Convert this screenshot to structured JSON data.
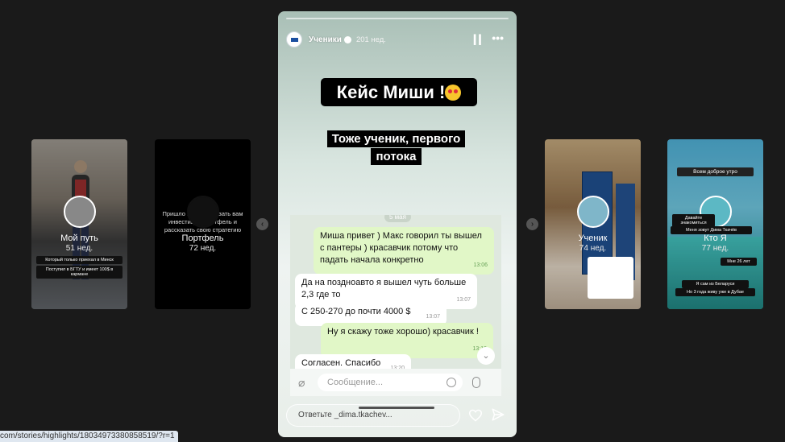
{
  "highlights": [
    {
      "name": "Мой путь",
      "age": "51 нед.",
      "tags": [
        "Который только приехал в Минск",
        "Поступил в БГТУ и имеет 100$ в кармане"
      ]
    },
    {
      "name": "Портфель",
      "age": "72 нед.",
      "text": "Пришло время показать вам инвестиции, портфель и рассказать свою стратегию"
    },
    {
      "name": "Ученик",
      "age": "74 нед."
    },
    {
      "name": "Кто Я",
      "age": "77 нед.",
      "tags": [
        "Всем доброе утро",
        "Давайте знакомиться",
        "Меня зовут Дима Ткачёв",
        "Мне 26 лет",
        "Я сам из Беларуси",
        "Но 3 года живу уже в Дубае"
      ]
    }
  ],
  "story": {
    "user": "Ученики",
    "time": "201 нед.",
    "caption_main": "Кейс Миши !",
    "caption_sub": "Тоже ученик, первого потока",
    "chat": {
      "date": "5 мая",
      "messages": [
        {
          "dir": "out",
          "text": "Миша привет ) Макс говорил ты вышел с пантеры ) красавчик потому что падать начала конкретно",
          "time": "13:06"
        },
        {
          "dir": "in",
          "text": "Да на поздноавто я вышел чуть больше 2,3 где то",
          "time": "13:07"
        },
        {
          "dir": "in",
          "text": "С 250-270 до почти 4000 $",
          "time": "13:07"
        },
        {
          "dir": "out",
          "text": "Ну я скажу тоже хорошо) красавчик !",
          "time": "13:19"
        },
        {
          "dir": "in",
          "text": "Согласен. Спасибо",
          "time": "13:20"
        }
      ],
      "input_placeholder": "Сообщение..."
    },
    "reply_placeholder": "Ответьте _dima.tkachev..."
  },
  "status_url": "com/stories/highlights/18034973380858519/?r=1",
  "icons": [
    "pause-icon",
    "more-icon",
    "heart-icon",
    "send-icon",
    "prev-arrow-icon",
    "next-arrow-icon"
  ]
}
